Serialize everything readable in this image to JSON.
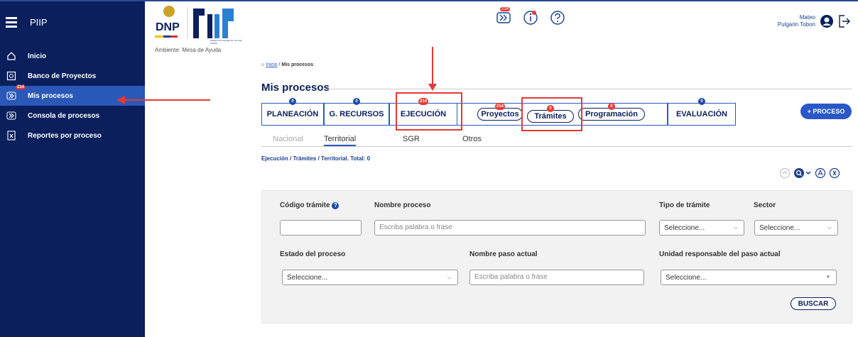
{
  "app": {
    "brand": "PIIP",
    "ambiente": "Ambiente: Mesa de Ayuda",
    "logo_text": "DNP",
    "logo_sub": "Plataforma Integrada de Inversión Pública"
  },
  "sidebar": {
    "items": [
      {
        "label": "Inicio"
      },
      {
        "label": "Banco de Proyectos"
      },
      {
        "label": "Mis procesos",
        "badge": "214"
      },
      {
        "label": "Consola de procesos"
      },
      {
        "label": "Reportes por proceso"
      }
    ]
  },
  "header": {
    "badge": "214",
    "user_first": "Mateo",
    "user_last": "Pulgarin Tobon"
  },
  "breadcrumb": {
    "home": "Inicio",
    "current": "Mis procesos"
  },
  "page": {
    "title": "Mis procesos"
  },
  "steps": [
    {
      "label": "PLANEACIÓN",
      "count": "0"
    },
    {
      "label": "G. RECURSOS",
      "count": "0"
    },
    {
      "label": "EJECUCIÓN",
      "count": "214"
    },
    {
      "label": "EVALUACIÓN",
      "count": "0"
    }
  ],
  "subtabs": [
    {
      "label": "Proyectos",
      "count": "214"
    },
    {
      "label": "Trámites",
      "count": "0"
    },
    {
      "label": "Programación",
      "count": "0"
    }
  ],
  "proceso_button": "+ PROCESO",
  "tabs": [
    "Nacional",
    "Territorial",
    "SGR",
    "Otros"
  ],
  "summary": "Ejecución / Trámites / Territorial. Total: 0",
  "filters": {
    "codigo": "Código trámite",
    "nombre": "Nombre proceso",
    "nombre_ph": "Escriba palabra o frase",
    "tipo": "Tipo de trámite",
    "tipo_val": "Seleccione...",
    "sector": "Sector",
    "sector_val": "Seleccione...",
    "estado": "Estado del proceso",
    "estado_val": "Seleccione...",
    "paso": "Nombre paso actual",
    "paso_ph": "Escriba palabra o frase",
    "unidad": "Unidad responsable del paso actual",
    "unidad_val": "Seleccione...",
    "buscar": "BUSCAR"
  }
}
